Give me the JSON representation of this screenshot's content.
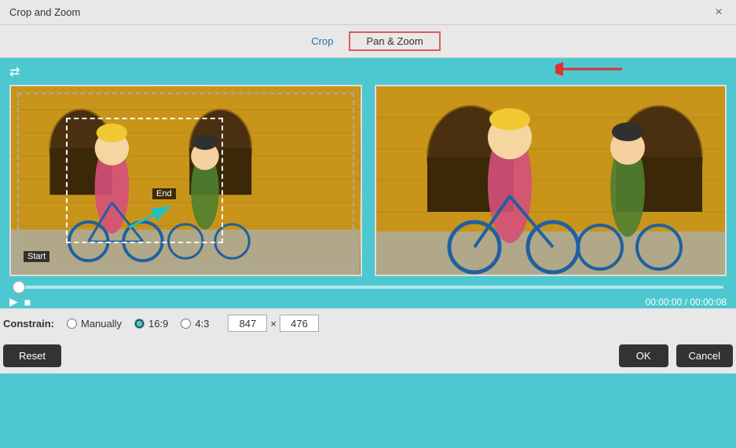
{
  "window": {
    "title": "Crop and Zoom",
    "close_label": "×"
  },
  "tabs": {
    "crop_label": "Crop",
    "pan_zoom_label": "Pan & Zoom"
  },
  "toolbar": {
    "repeat_icon": "⇄"
  },
  "images": {
    "left_alt": "Source video with pan and zoom selection",
    "right_alt": "Preview of zoomed output",
    "start_label": "Start",
    "end_label": "End"
  },
  "timeline": {
    "timecode": "00:00:00 / 00:00:08"
  },
  "playback": {
    "play_icon": "▶",
    "stop_icon": "■"
  },
  "constrain": {
    "label": "Constrain:",
    "manually_label": "Manually",
    "ratio_16_9_label": "16:9",
    "ratio_4_3_label": "4:3",
    "width_value": "847",
    "height_value": "476",
    "separator": "×"
  },
  "buttons": {
    "reset_label": "Reset",
    "ok_label": "OK",
    "cancel_label": "Cancel"
  },
  "colors": {
    "background": "#4dc8d0",
    "title_bar": "#e8e8e8",
    "active_tab_border": "#e05a5a",
    "button_bg": "#333333"
  }
}
